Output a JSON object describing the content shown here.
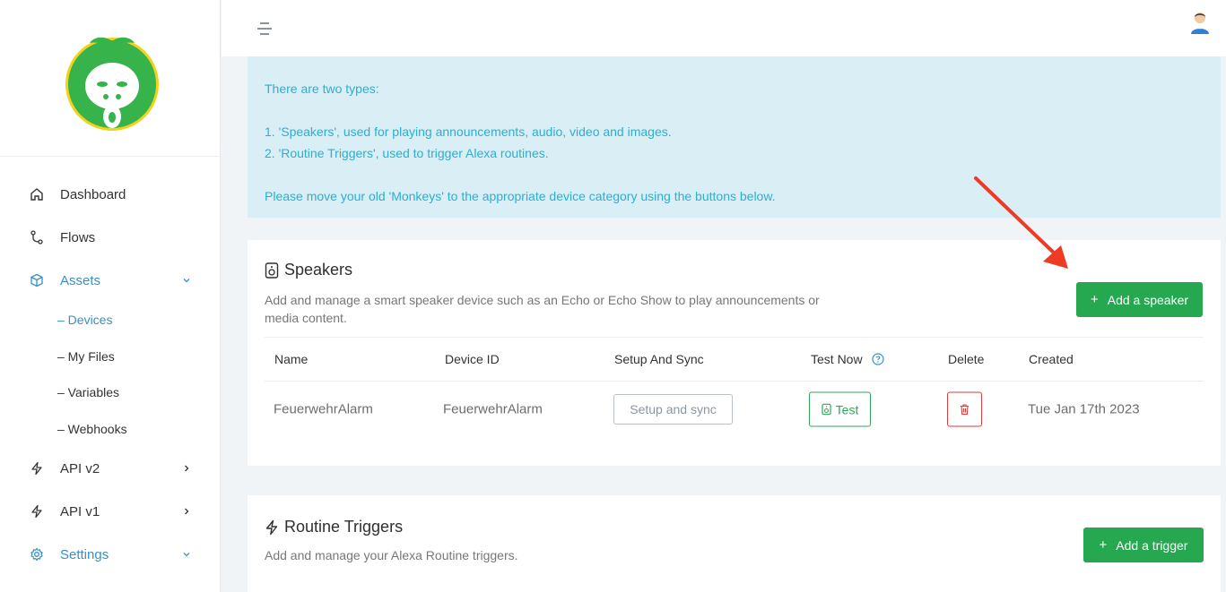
{
  "sidebar": {
    "items": [
      {
        "label": "Dashboard",
        "icon": "home-icon"
      },
      {
        "label": "Flows",
        "icon": "flows-icon"
      },
      {
        "label": "Assets",
        "icon": "cube-icon",
        "active": true
      },
      {
        "label": "API v2",
        "icon": "bolt-icon"
      },
      {
        "label": "API v1",
        "icon": "bolt-icon"
      },
      {
        "label": "Settings",
        "icon": "gear-icon",
        "active": true
      }
    ],
    "sub_items": [
      "– Devices",
      "– My Files",
      "– Variables",
      "– Webhooks"
    ]
  },
  "info": {
    "line1": "There are two types:",
    "line2": "1. 'Speakers', used for playing announcements, audio, video and images.",
    "line3": "2. 'Routine Triggers', used to trigger Alexa routines.",
    "line4": "Please move your old 'Monkeys' to the appropriate device category using the buttons below."
  },
  "speakers": {
    "title": "Speakers",
    "description_line1": "Add and manage a smart speaker device such as an Echo or Echo Show to play announcements or",
    "description_line2": "media content.",
    "add_button": "Add a speaker",
    "columns": {
      "name": "Name",
      "device_id": "Device ID",
      "setup": "Setup And Sync",
      "test": "Test Now",
      "delete": "Delete",
      "created": "Created"
    },
    "rows": [
      {
        "name": "FeuerwehrAlarm",
        "device_id": "FeuerwehrAlarm",
        "setup_button": "Setup and sync",
        "test_button": "Test",
        "created": "Tue Jan 17th 2023"
      }
    ]
  },
  "triggers": {
    "title": "Routine Triggers",
    "description": "Add and manage your Alexa Routine triggers.",
    "add_button": "Add a trigger"
  },
  "colors": {
    "accent_green": "#25a84f",
    "info_bg": "#d9eef5",
    "info_text": "#29b0d3",
    "active_nav": "#3a8fc7",
    "delete_red": "#dc3b3b",
    "arrow_red": "#ee3b24"
  }
}
